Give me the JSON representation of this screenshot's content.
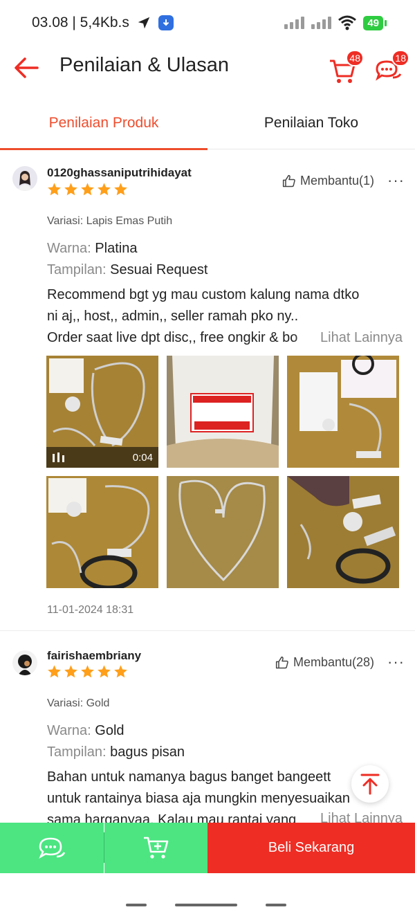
{
  "status_bar": {
    "time_speed": "03.08 | 5,4Kb.s",
    "battery": "49"
  },
  "header": {
    "title": "Penilaian & Ulasan",
    "cart_count": "48",
    "chat_count": "18"
  },
  "tabs": [
    {
      "label": "Penilaian Produk",
      "active": true
    },
    {
      "label": "Penilaian Toko",
      "active": false
    }
  ],
  "reviews": [
    {
      "username": "0120ghassaniputrihidayat",
      "rating": 5,
      "helpful": "Membantu(1)",
      "variant": "Variasi: Lapis Emas Putih",
      "attrs": [
        {
          "key": "Warna:",
          "value": "Platina"
        },
        {
          "key": "Tampilan:",
          "value": "Sesuai Request"
        }
      ],
      "lines": [
        "Recommend bgt yg mau custom kalung nama dtko",
        "ni aj,, host,, admin,, seller ramah pko ny..",
        "Order saat live dpt disc,, free ongkir & bo"
      ],
      "see_more": "Lihat Lainnya",
      "video_duration": "0:04",
      "timestamp": "11-01-2024 18:31"
    },
    {
      "username": "fairishaembriany",
      "rating": 5,
      "helpful": "Membantu(28)",
      "variant": "Variasi: Gold",
      "attrs": [
        {
          "key": "Warna:",
          "value": "Gold"
        },
        {
          "key": "Tampilan:",
          "value": "bagus pisan"
        }
      ],
      "lines": [
        "Bahan untuk namanya bagus banget bangeett",
        "untuk rantainya biasa aja mungkin menyesuaikan",
        "sama harganyaa. Kalau mau rantai yang"
      ],
      "see_more": "Lihat Lainnya"
    }
  ],
  "bottom_bar": {
    "buy_label": "Beli Sekarang"
  },
  "colors": {
    "accent": "#ee4d2d",
    "buy": "#ee2d24",
    "green": "#4ce582",
    "star": "#ff9f1a"
  }
}
